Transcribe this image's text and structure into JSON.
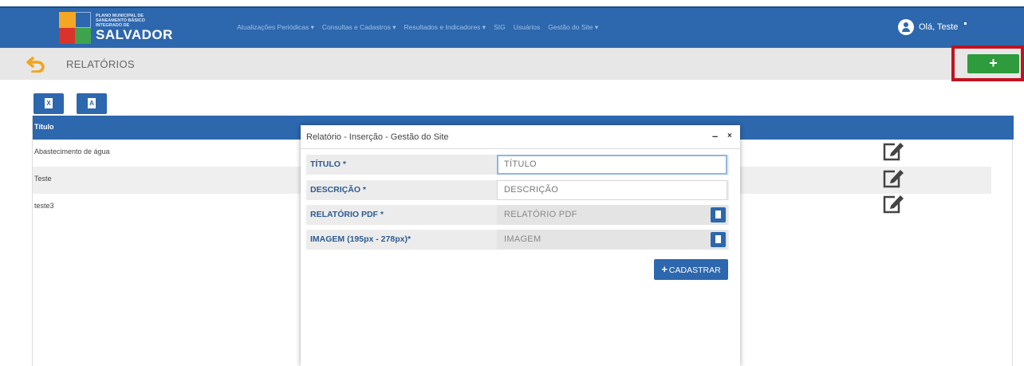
{
  "header": {
    "logo": {
      "small_text": "PLANO MUNICIPAL DE SANEAMENTO BÁSICO INTEGRADO DE",
      "big_text": "SALVADOR"
    },
    "nav": [
      "Atualizações Periódicas ▾",
      "Consultas e Cadastros ▾",
      "Resultados e Indicadores ▾",
      "SIG",
      "Usuários",
      "Gestão do Site ▾"
    ],
    "user_greeting": "Olá, Teste"
  },
  "titlebar": {
    "title": "RELATÓRIOS",
    "add_label": "+"
  },
  "export": {
    "excel_glyph": "X",
    "pdf_glyph": "A"
  },
  "table": {
    "header": "Título",
    "rows": [
      "Abastecimento de água",
      "Teste",
      "teste3"
    ]
  },
  "modal": {
    "title": "Relatório - Inserção - Gestão do Site",
    "minimize": "–",
    "close": "×",
    "fields": [
      {
        "label": "TÍTULO *",
        "placeholder": "TÍTULO"
      },
      {
        "label": "DESCRIÇÃO *",
        "placeholder": "DESCRIÇÃO"
      },
      {
        "label": "RELATÓRIO PDF *",
        "placeholder": "RELATÓRIO PDF"
      },
      {
        "label": "IMAGEM (195px - 278px)*",
        "placeholder": "IMAGEM"
      }
    ],
    "submit_icon": "+",
    "submit_label": "CADASTRAR"
  },
  "colors": {
    "primary": "#2d67ad",
    "success": "#2e9b3c",
    "highlight": "#c1121f"
  }
}
